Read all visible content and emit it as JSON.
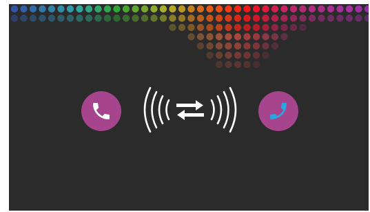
{
  "icons": {
    "left": "phone-handset-icon",
    "center": "signal-transfer-icon",
    "right": "phone-handset-icon"
  },
  "colors": {
    "background": "#2b2b2b",
    "icon_circle": "#a6448e",
    "left_handset": "#ffffff",
    "right_handset": "#2aa6e0",
    "waves": "#ffffff"
  }
}
